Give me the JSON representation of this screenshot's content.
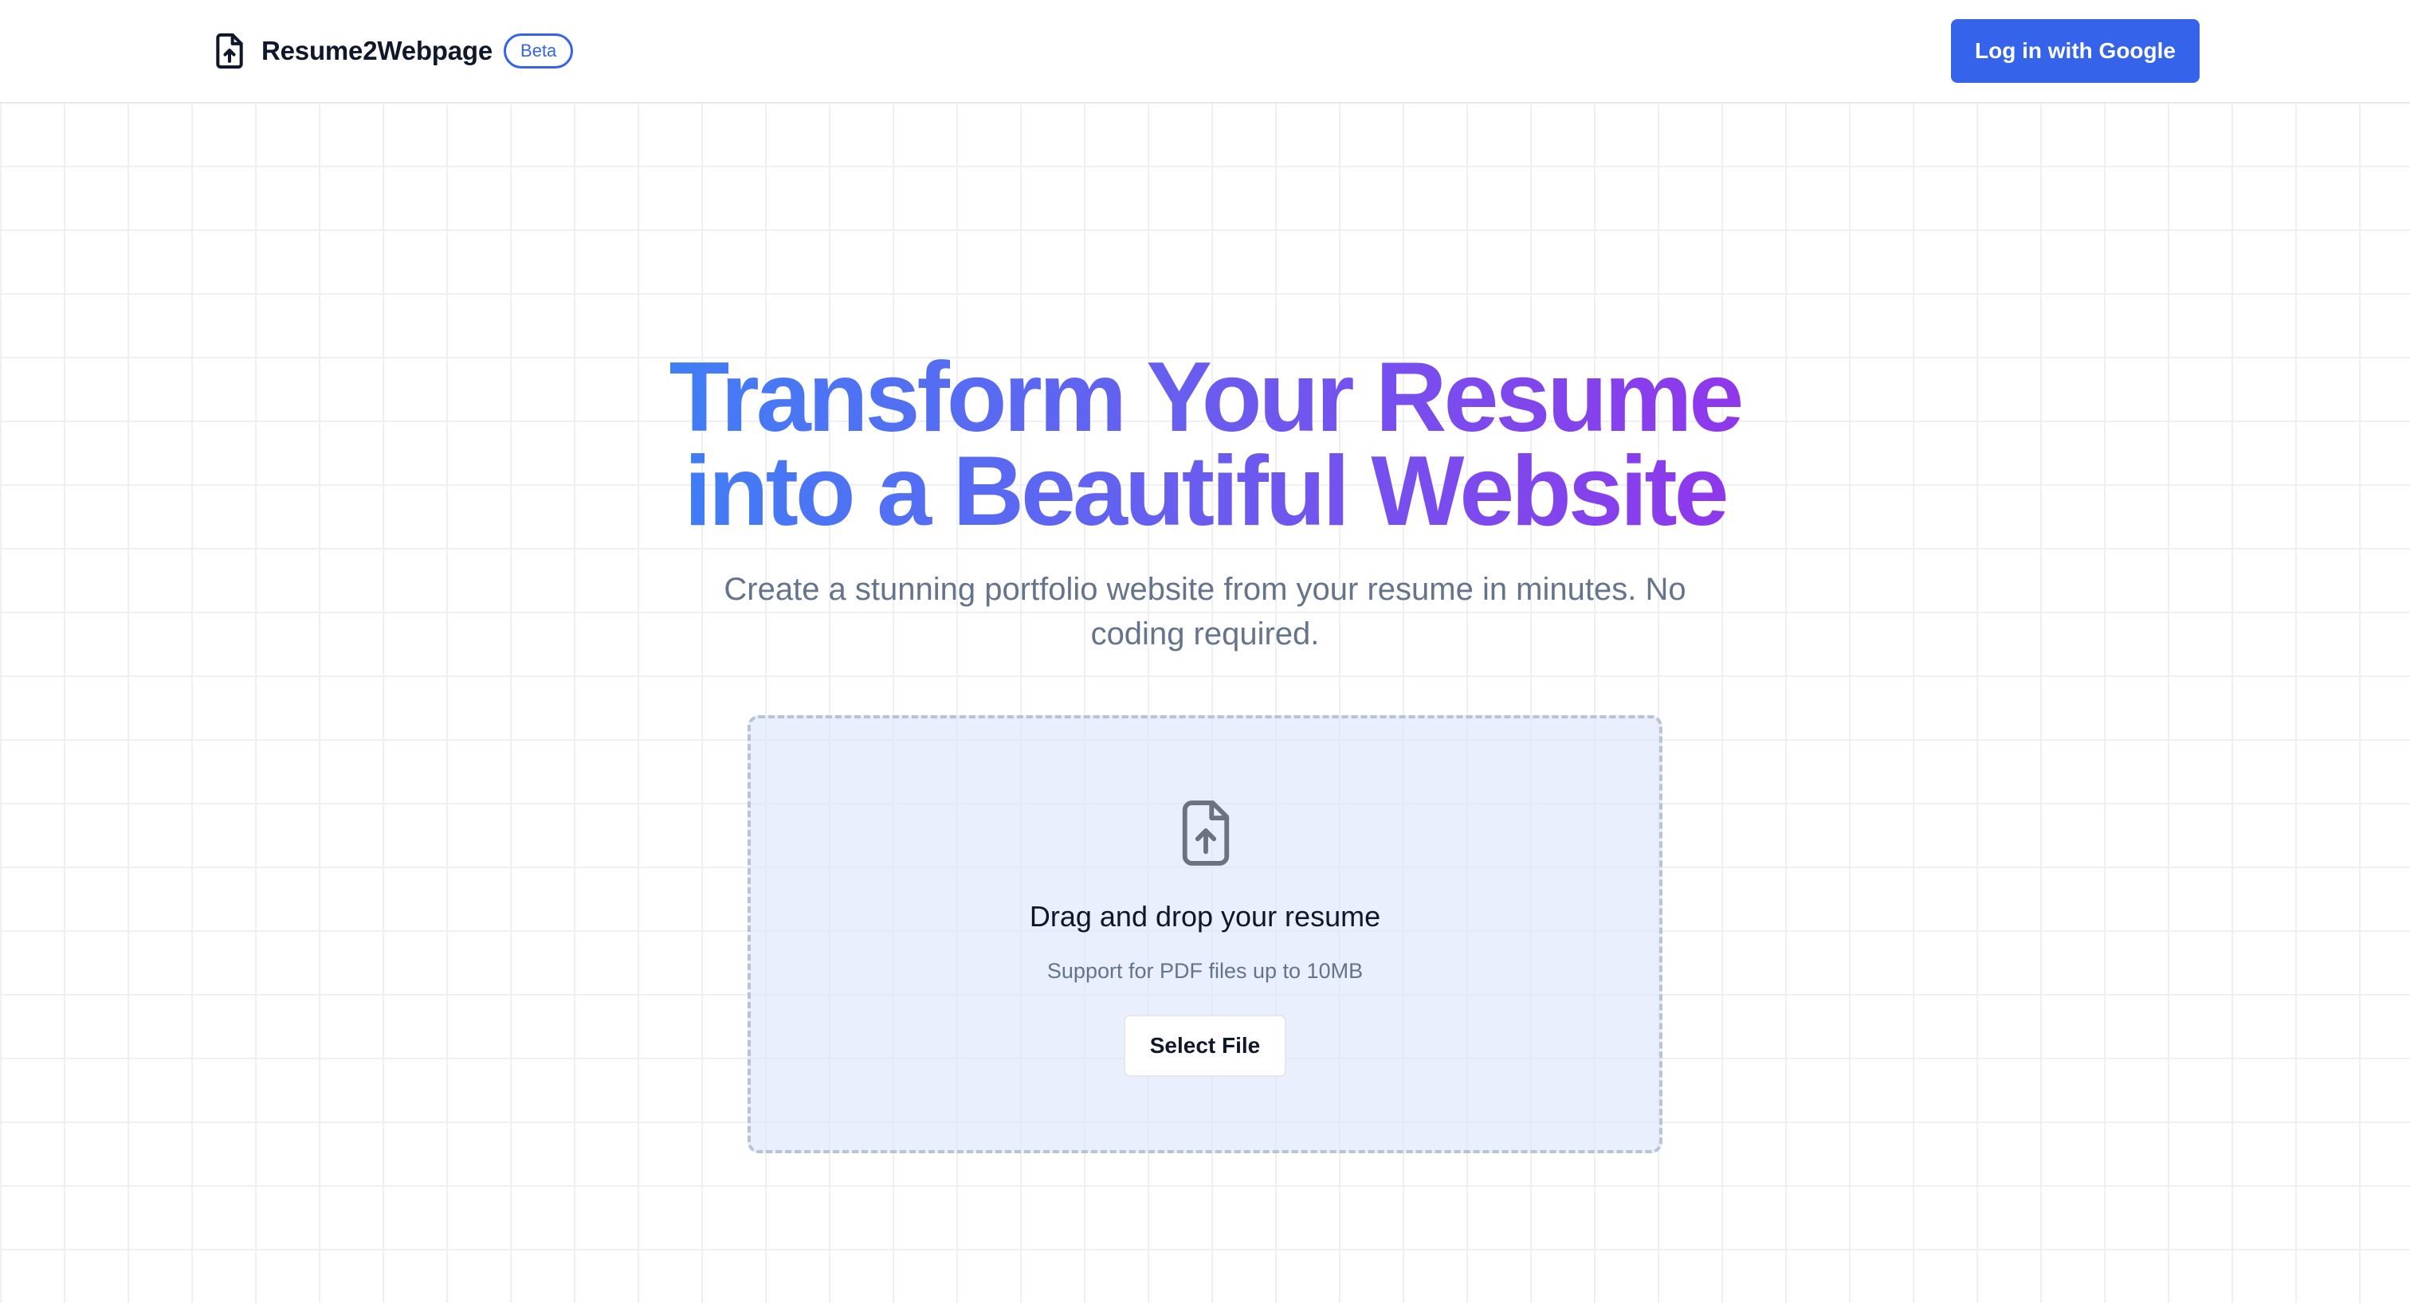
{
  "header": {
    "brand_name": "Resume2Webpage",
    "badge": "Beta",
    "brand_icon": "file-upload-icon",
    "login_label": "Log in with Google"
  },
  "hero": {
    "title_line1": "Transform Your Resume",
    "title_line2": "into a Beautiful Website",
    "subtitle": "Create a stunning portfolio website from your resume in minutes. No coding required."
  },
  "dropzone": {
    "icon": "file-upload-icon",
    "title": "Drag and drop your resume",
    "hint": "Support for PDF files up to 10MB",
    "button_label": "Select File"
  },
  "colors": {
    "accent": "#3563e9",
    "gradient_start": "#3b82f6",
    "gradient_end": "#9333ea",
    "muted_text": "#64748b"
  }
}
